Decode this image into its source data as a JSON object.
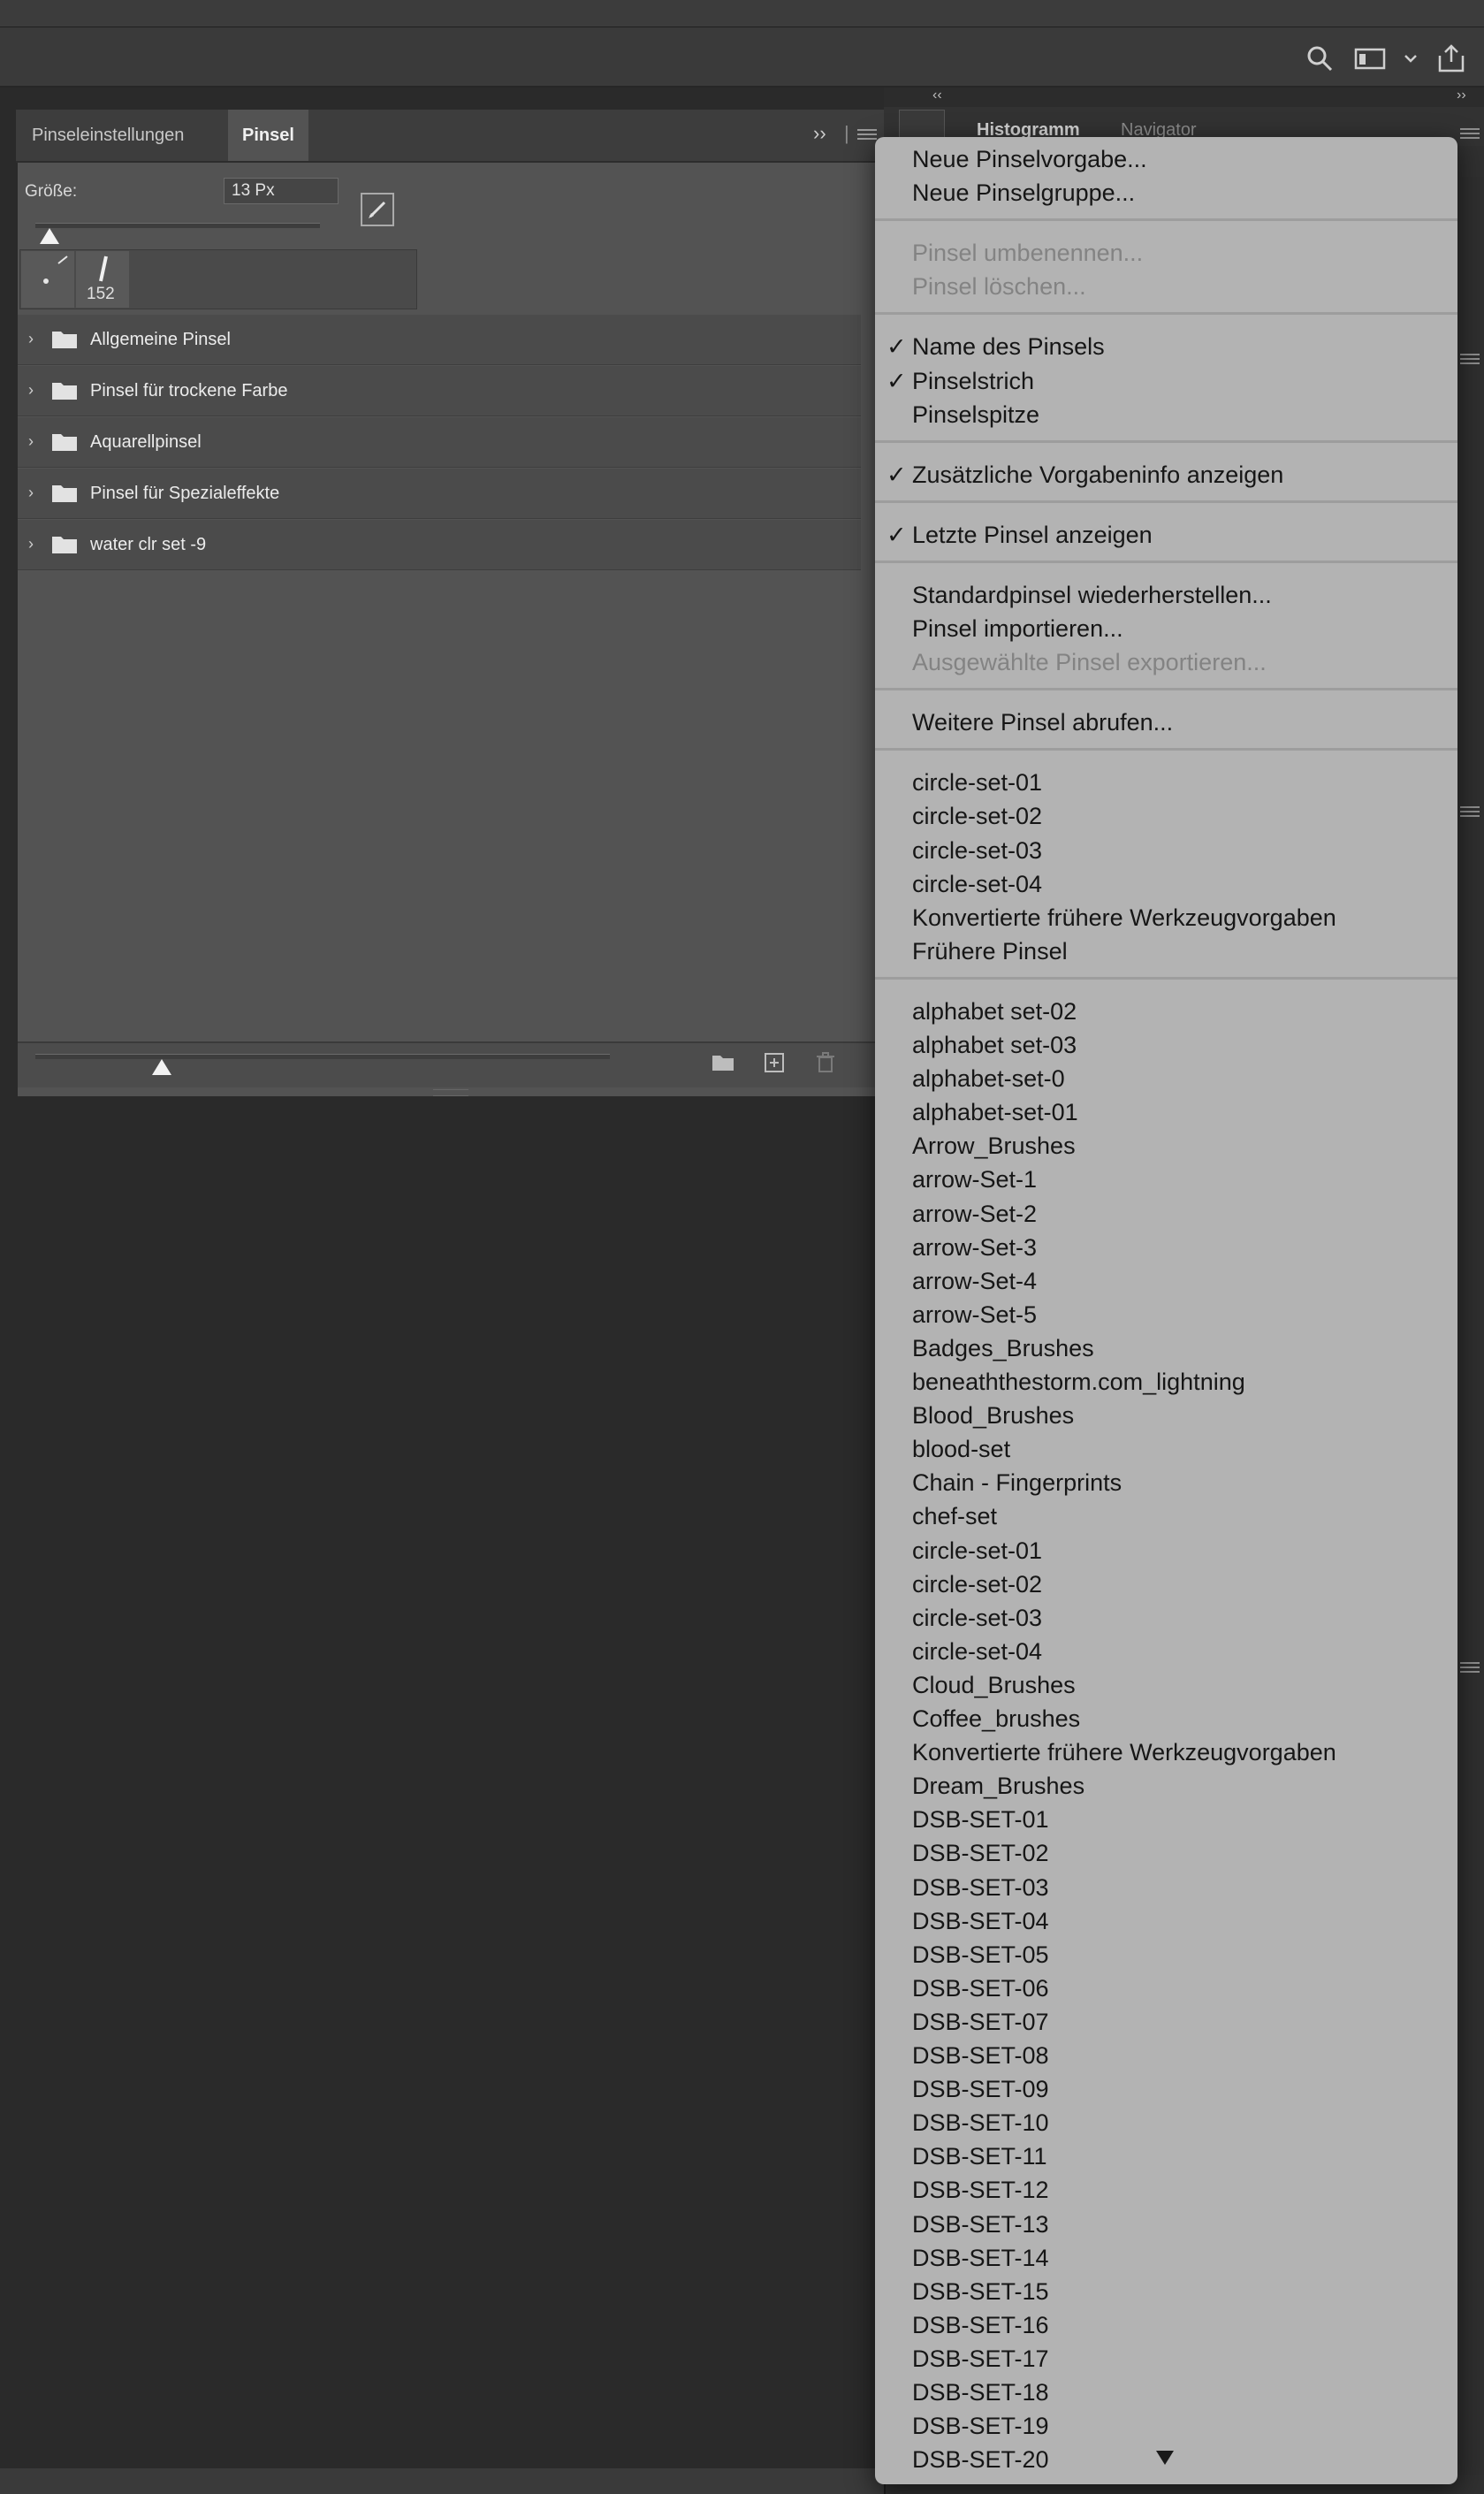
{
  "toolbar": {
    "icons": [
      "search-icon",
      "workspace-icon",
      "chevron-down-icon",
      "share-icon"
    ]
  },
  "dock": {
    "tabs": [
      "Histogramm",
      "Navigator"
    ]
  },
  "brush_panel": {
    "tabs": [
      "Pinseleinstellungen",
      "Pinsel"
    ],
    "active_tab": "Pinsel",
    "size_label": "Größe:",
    "size_value": "13 Px",
    "size_slider_fraction": 0.05,
    "recent_brush_count": "152",
    "folders": [
      {
        "label": "Allgemeine Pinsel"
      },
      {
        "label": "Pinsel für trockene Farbe"
      },
      {
        "label": "Aquarellpinsel"
      },
      {
        "label": "Pinsel für Spezialeffekte"
      },
      {
        "label": "water clr set -9"
      }
    ],
    "preview_slider_fraction": 0.22
  },
  "menu": {
    "groups": [
      {
        "items": [
          {
            "label": "Neue Pinselvorgabe...",
            "enabled": true,
            "checked": false
          },
          {
            "label": "Neue Pinselgruppe...",
            "enabled": true,
            "checked": false
          }
        ]
      },
      {
        "items": [
          {
            "label": "Pinsel umbenennen...",
            "enabled": false,
            "checked": false
          },
          {
            "label": "Pinsel löschen...",
            "enabled": false,
            "checked": false
          }
        ]
      },
      {
        "items": [
          {
            "label": "Name des Pinsels",
            "enabled": true,
            "checked": true
          },
          {
            "label": "Pinselstrich",
            "enabled": true,
            "checked": true
          },
          {
            "label": "Pinselspitze",
            "enabled": true,
            "checked": false
          }
        ]
      },
      {
        "items": [
          {
            "label": "Zusätzliche Vorgabeninfo anzeigen",
            "enabled": true,
            "checked": true
          }
        ]
      },
      {
        "items": [
          {
            "label": "Letzte Pinsel anzeigen",
            "enabled": true,
            "checked": true
          }
        ]
      },
      {
        "items": [
          {
            "label": "Standardpinsel wiederherstellen...",
            "enabled": true,
            "checked": false
          },
          {
            "label": "Pinsel importieren...",
            "enabled": true,
            "checked": false
          },
          {
            "label": "Ausgewählte Pinsel exportieren...",
            "enabled": false,
            "checked": false
          }
        ]
      },
      {
        "items": [
          {
            "label": "Weitere Pinsel abrufen...",
            "enabled": true,
            "checked": false
          }
        ]
      },
      {
        "items": [
          {
            "label": "circle-set-01",
            "enabled": true,
            "checked": false
          },
          {
            "label": "circle-set-02",
            "enabled": true,
            "checked": false
          },
          {
            "label": "circle-set-03",
            "enabled": true,
            "checked": false
          },
          {
            "label": "circle-set-04",
            "enabled": true,
            "checked": false
          },
          {
            "label": "Konvertierte frühere Werkzeugvorgaben",
            "enabled": true,
            "checked": false
          },
          {
            "label": "Frühere Pinsel",
            "enabled": true,
            "checked": false
          }
        ]
      },
      {
        "items": [
          {
            "label": "alphabet set-02",
            "enabled": true,
            "checked": false
          },
          {
            "label": "alphabet set-03",
            "enabled": true,
            "checked": false
          },
          {
            "label": "alphabet-set-0",
            "enabled": true,
            "checked": false
          },
          {
            "label": "alphabet-set-01",
            "enabled": true,
            "checked": false
          },
          {
            "label": "Arrow_Brushes",
            "enabled": true,
            "checked": false
          },
          {
            "label": "arrow-Set-1",
            "enabled": true,
            "checked": false
          },
          {
            "label": "arrow-Set-2",
            "enabled": true,
            "checked": false
          },
          {
            "label": "arrow-Set-3",
            "enabled": true,
            "checked": false
          },
          {
            "label": "arrow-Set-4",
            "enabled": true,
            "checked": false
          },
          {
            "label": "arrow-Set-5",
            "enabled": true,
            "checked": false
          },
          {
            "label": "Badges_Brushes",
            "enabled": true,
            "checked": false
          },
          {
            "label": "beneaththestorm.com_lightning",
            "enabled": true,
            "checked": false
          },
          {
            "label": "Blood_Brushes",
            "enabled": true,
            "checked": false
          },
          {
            "label": "blood-set",
            "enabled": true,
            "checked": false
          },
          {
            "label": "Chain - Fingerprints",
            "enabled": true,
            "checked": false
          },
          {
            "label": "chef-set",
            "enabled": true,
            "checked": false
          },
          {
            "label": "circle-set-01",
            "enabled": true,
            "checked": false
          },
          {
            "label": "circle-set-02",
            "enabled": true,
            "checked": false
          },
          {
            "label": "circle-set-03",
            "enabled": true,
            "checked": false
          },
          {
            "label": "circle-set-04",
            "enabled": true,
            "checked": false
          },
          {
            "label": "Cloud_Brushes",
            "enabled": true,
            "checked": false
          },
          {
            "label": "Coffee_brushes",
            "enabled": true,
            "checked": false
          },
          {
            "label": "Konvertierte frühere Werkzeugvorgaben",
            "enabled": true,
            "checked": false
          },
          {
            "label": "Dream_Brushes",
            "enabled": true,
            "checked": false
          },
          {
            "label": "DSB-SET-01",
            "enabled": true,
            "checked": false
          },
          {
            "label": "DSB-SET-02",
            "enabled": true,
            "checked": false
          },
          {
            "label": "DSB-SET-03",
            "enabled": true,
            "checked": false
          },
          {
            "label": "DSB-SET-04",
            "enabled": true,
            "checked": false
          },
          {
            "label": "DSB-SET-05",
            "enabled": true,
            "checked": false
          },
          {
            "label": "DSB-SET-06",
            "enabled": true,
            "checked": false
          },
          {
            "label": "DSB-SET-07",
            "enabled": true,
            "checked": false
          },
          {
            "label": "DSB-SET-08",
            "enabled": true,
            "checked": false
          },
          {
            "label": "DSB-SET-09",
            "enabled": true,
            "checked": false
          },
          {
            "label": "DSB-SET-10",
            "enabled": true,
            "checked": false
          },
          {
            "label": "DSB-SET-11",
            "enabled": true,
            "checked": false
          },
          {
            "label": "DSB-SET-12",
            "enabled": true,
            "checked": false
          },
          {
            "label": "DSB-SET-13",
            "enabled": true,
            "checked": false
          },
          {
            "label": "DSB-SET-14",
            "enabled": true,
            "checked": false
          },
          {
            "label": "DSB-SET-15",
            "enabled": true,
            "checked": false
          },
          {
            "label": "DSB-SET-16",
            "enabled": true,
            "checked": false
          },
          {
            "label": "DSB-SET-17",
            "enabled": true,
            "checked": false
          },
          {
            "label": "DSB-SET-18",
            "enabled": true,
            "checked": false
          },
          {
            "label": "DSB-SET-19",
            "enabled": true,
            "checked": false
          },
          {
            "label": "DSB-SET-20",
            "enabled": true,
            "checked": false
          }
        ]
      }
    ]
  }
}
